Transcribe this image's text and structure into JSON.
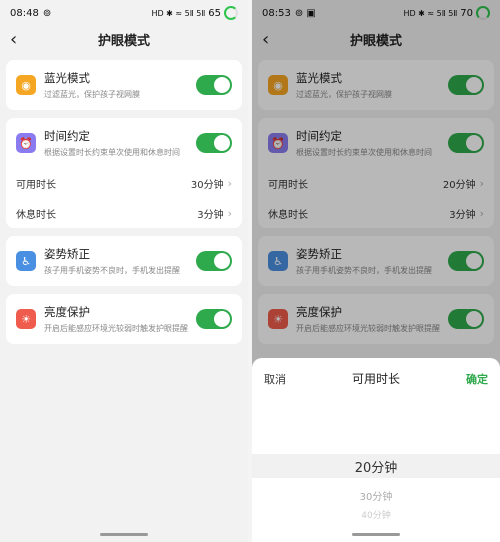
{
  "left": {
    "status": {
      "time": "08:48",
      "extra": "⊚",
      "battery": "65",
      "net": "HD ✱ ≈ 5Ⅱ 5Ⅱ"
    },
    "nav": {
      "title": "护眼模式"
    },
    "items": [
      {
        "title": "蓝光模式",
        "subtitle": "过滤蓝光，保护孩子视网膜"
      },
      {
        "title": "时间约定",
        "subtitle": "根据设置时长约束单次使用和休息时间"
      },
      {
        "title": "姿势矫正",
        "subtitle": "孩子用手机姿势不良时，手机发出提醒"
      },
      {
        "title": "亮度保护",
        "subtitle": "开启后能感应环境光较弱时触发护眼提醒"
      }
    ],
    "rows": {
      "available_label": "可用时长",
      "available_value": "30分钟",
      "rest_label": "休息时长",
      "rest_value": "3分钟"
    }
  },
  "right": {
    "status": {
      "time": "08:53",
      "extra": "⊚ ▣",
      "battery": "70",
      "net": "HD ✱ ≈ 5Ⅱ 5Ⅱ"
    },
    "nav": {
      "title": "护眼模式"
    },
    "items": [
      {
        "title": "蓝光模式",
        "subtitle": "过滤蓝光，保护孩子视网膜"
      },
      {
        "title": "时间约定",
        "subtitle": "根据设置时长约束单次使用和休息时间"
      },
      {
        "title": "姿势矫正",
        "subtitle": "孩子用手机姿势不良时，手机发出提醒"
      },
      {
        "title": "亮度保护",
        "subtitle": "开启后能感应环境光较弱时触发护眼提醒"
      }
    ],
    "rows": {
      "available_label": "可用时长",
      "available_value": "20分钟",
      "rest_label": "休息时长",
      "rest_value": "3分钟"
    },
    "sheet": {
      "cancel": "取消",
      "title": "可用时长",
      "confirm": "确定",
      "options": [
        "20分钟",
        "30分钟",
        "40分钟"
      ]
    }
  },
  "colors": {
    "accent": "#2ea94c",
    "blue_icon": "#f5a623",
    "time_icon": "#8a7cf0",
    "posture_icon": "#4a90e2",
    "bright_icon": "#ef5b4c"
  }
}
